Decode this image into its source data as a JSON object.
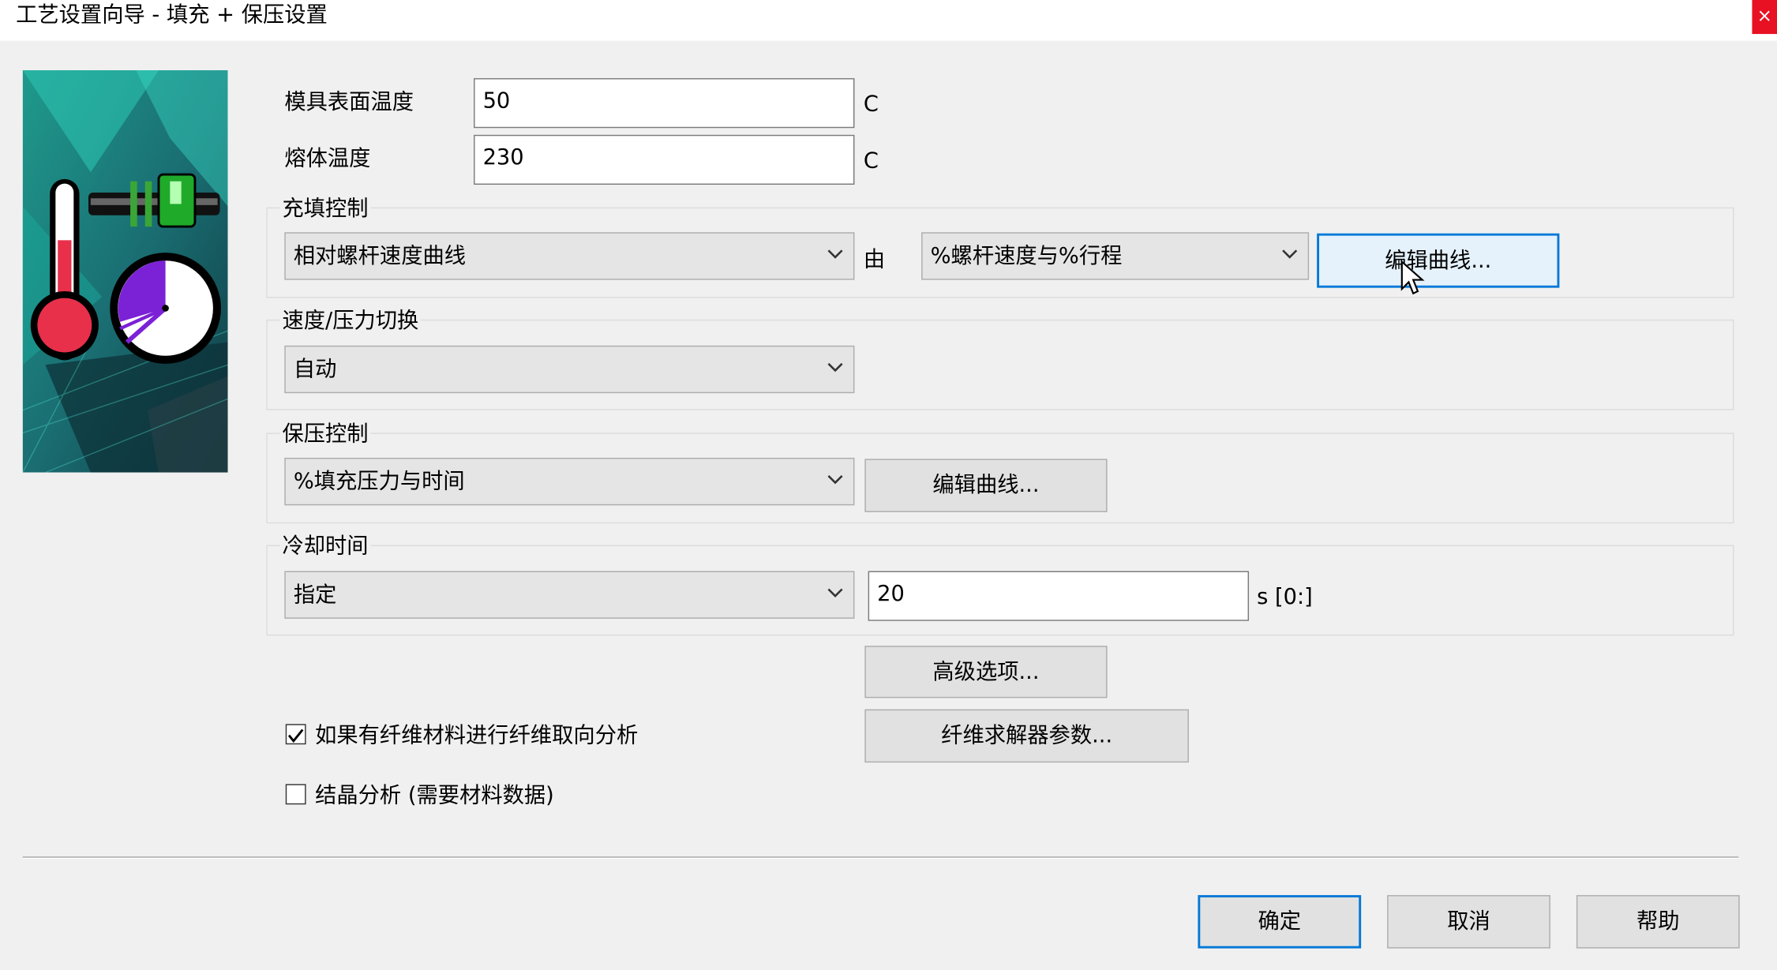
{
  "window": {
    "title": "工艺设置向导 - 填充 + 保压设置",
    "close_glyph": "×"
  },
  "mold_temp": {
    "label": "模具表面温度",
    "value": "50",
    "unit": "C"
  },
  "melt_temp": {
    "label": "熔体温度",
    "value": "230",
    "unit": "C"
  },
  "fill_control": {
    "group_label": "充填控制",
    "mode": "相对螺杆速度曲线",
    "by_label": "由",
    "profile": "%螺杆速度与%行程",
    "edit_button": "编辑曲线..."
  },
  "switchover": {
    "group_label": "速度/压力切换",
    "mode": "自动"
  },
  "pack_control": {
    "group_label": "保压控制",
    "mode": "%填充压力与时间",
    "edit_button": "编辑曲线..."
  },
  "cooling_time": {
    "group_label": "冷却时间",
    "mode": "指定",
    "value": "20",
    "unit": "s [0:]"
  },
  "advanced_button": "高级选项...",
  "fiber_check": {
    "label": "如果有纤维材料进行纤维取向分析",
    "checked": true
  },
  "fiber_solver_button": "纤维求解器参数...",
  "crystal_check": {
    "label": "结晶分析 (需要材料数据)",
    "checked": false
  },
  "footer": {
    "ok": "确定",
    "cancel": "取消",
    "help": "帮助"
  },
  "icons": {
    "wizard_image": "thermometer-clock-illustration",
    "chevron": "chevron-down-icon",
    "cursor": "mouse-pointer-icon"
  },
  "colors": {
    "accent": "#0078d7",
    "hot_bg": "#e5f1fb",
    "dialog_bg": "#f0f0f0",
    "close_red": "#e81123"
  }
}
